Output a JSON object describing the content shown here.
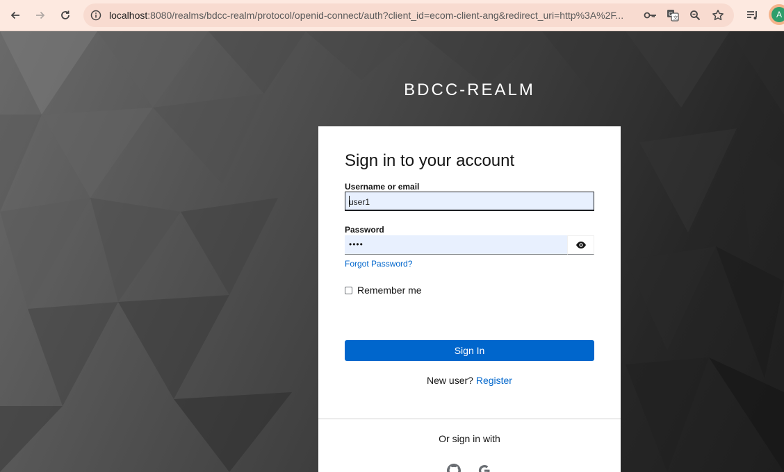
{
  "browser": {
    "url_host": "localhost",
    "url_rest": ":8080/realms/bdcc-realm/protocol/openid-connect/auth?client_id=ecom-client-ang&redirect_uri=http%3A%2F...",
    "icons": [
      "back-arrow-icon",
      "forward-arrow-icon",
      "reload-icon",
      "site-info-icon",
      "password-key-icon",
      "translate-icon",
      "zoom-icon",
      "bookmark-star-icon",
      "reading-list-icon"
    ],
    "avatar_letter": "A"
  },
  "realm": {
    "title": "BDCC-REALM"
  },
  "login": {
    "heading": "Sign in to your account",
    "username_label": "Username or email",
    "username_value": "user1",
    "password_label": "Password",
    "password_value": "••••",
    "forgot_password": "Forgot Password?",
    "remember_me": "Remember me",
    "remember_checked": false,
    "sign_in": "Sign In",
    "new_user_text": "New user?",
    "register": "Register",
    "or_sign_in_with": "Or sign in with",
    "providers": [
      "github-icon",
      "google-icon"
    ]
  },
  "colors": {
    "primary": "#0066cc",
    "input_bg": "#e8f0fe",
    "chrome_bg": "#fde9e0"
  }
}
